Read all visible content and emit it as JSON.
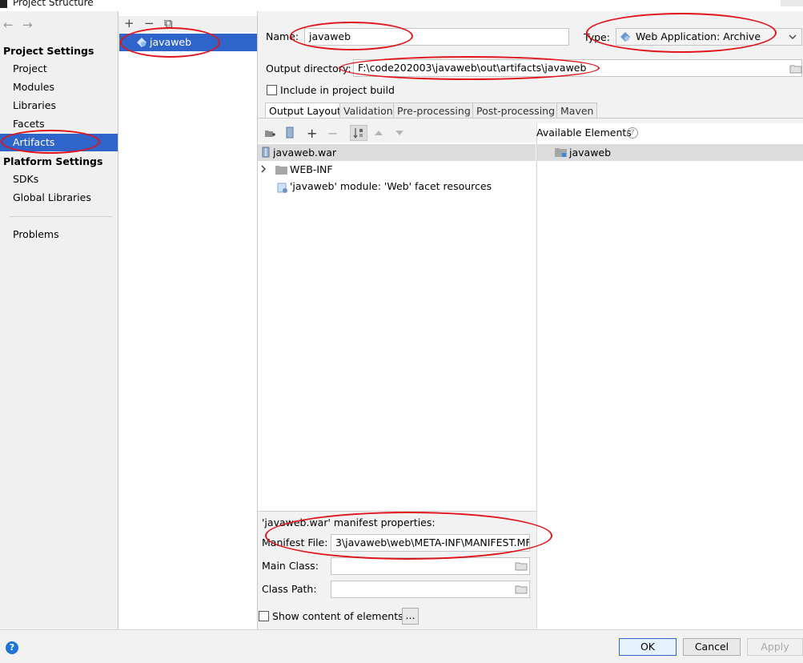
{
  "window": {
    "title": "Project Structure"
  },
  "nav": {
    "back_glyph": "←",
    "forward_glyph": "→",
    "project_settings_header": "Project Settings",
    "project_items": [
      "Project",
      "Modules",
      "Libraries",
      "Facets",
      "Artifacts"
    ],
    "selected_item": "Artifacts",
    "platform_settings_header": "Platform Settings",
    "platform_items": [
      "SDKs",
      "Global Libraries"
    ],
    "problems": "Problems"
  },
  "artifact_list": {
    "toolbar": {
      "add": "+",
      "remove": "−",
      "copy": "⧉"
    },
    "items": [
      "javaweb"
    ]
  },
  "form": {
    "name_label": "Name:",
    "name_value": "javaweb",
    "type_label": "Type:",
    "type_value": "Web Application: Archive",
    "output_label": "Output directory:",
    "output_value": "F:\\code202003\\javaweb\\out\\artifacts\\javaweb",
    "include_label": "Include in project build",
    "include_checked": false
  },
  "tabs": [
    "Output Layout",
    "Validation",
    "Pre-processing",
    "Post-processing",
    "Maven"
  ],
  "active_tab": "Output Layout",
  "output_layout": {
    "tree": [
      {
        "label": "javaweb.war",
        "icon": "archive-icon"
      },
      {
        "label": "WEB-INF",
        "icon": "folder-icon"
      },
      {
        "label": "'javaweb' module: 'Web' facet resources",
        "icon": "web-resource-icon"
      }
    ]
  },
  "available": {
    "header": "Available Elements",
    "items": [
      "javaweb"
    ]
  },
  "manifest": {
    "header": "'javaweb.war' manifest properties:",
    "file_label": "Manifest File:",
    "file_value": "3\\javaweb\\web\\META-INF\\MANIFEST.MF",
    "main_class_label": "Main Class:",
    "main_class_value": "",
    "class_path_label": "Class Path:",
    "class_path_value": ""
  },
  "show_content": {
    "label": "Show content of elements",
    "button": "...",
    "checked": false
  },
  "buttons": {
    "ok": "OK",
    "cancel": "Cancel",
    "apply": "Apply"
  },
  "colors": {
    "selection": "#2f65ca",
    "annotation": "#e0141a",
    "help": "#1e73d8"
  }
}
